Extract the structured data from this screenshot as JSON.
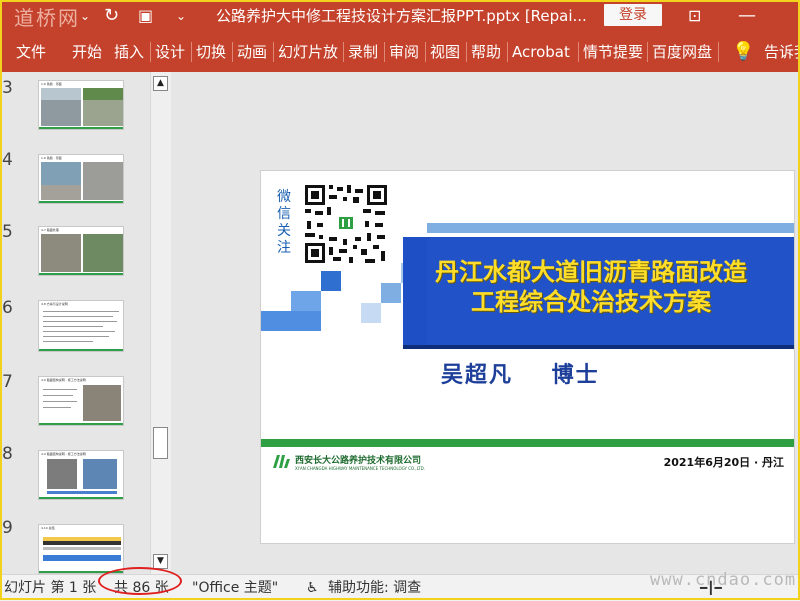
{
  "titlebar": {
    "watermark": "道桥网",
    "title": "公路养护大中修工程技设计方案汇报PPT.pptx [Repai...",
    "login_label": "登录"
  },
  "ribbon": {
    "tabs": [
      "文件",
      "开始",
      "插入",
      "设计",
      "切换",
      "动画",
      "幻灯片放",
      "录制",
      "审阅",
      "视图",
      "帮助",
      "Acrobat",
      "情节提要",
      "百度网盘",
      "告诉我"
    ]
  },
  "thumbnails": [
    {
      "num": "3",
      "title": "1.6 铣刨 · 罩面"
    },
    {
      "num": "4",
      "title": "1.6 铣刨 · 罩面"
    },
    {
      "num": "5",
      "title": "4.7 路面处理"
    },
    {
      "num": "6",
      "title": "4.8 方案与设计说明"
    },
    {
      "num": "7",
      "title": "4.9 路面结构说明 - 施工方法说明"
    },
    {
      "num": "8",
      "title": "4.9 路面结构说明 - 施工方法说明"
    },
    {
      "num": "9",
      "title": "4.10 总结"
    }
  ],
  "slide": {
    "wechat_label": "微信关注",
    "title_line1": "丹江水都大道旧沥青路面改造",
    "title_line2": "工程综合处治技术方案",
    "author": "吴超凡    博士",
    "company_cn": "西安长大公路养护技术有限公司",
    "company_en": "XI'AN CHANGDA HIGHWAY MAINTENANCE TECHNOLOGY CO.,LTD.",
    "date": "2021年6月20日 · 丹江"
  },
  "status": {
    "slide_pos": "幻灯片 第 1 张",
    "total": "共 86 张",
    "theme": "\"Office 主题\"",
    "accessibility": "辅助功能: 调查",
    "site_watermark": "www.cndao.com"
  },
  "colors": {
    "brand": "#c4422b",
    "slide_blue": "#1e4fc4",
    "slide_green": "#2ea043",
    "title_yellow": "#ffde2a"
  }
}
